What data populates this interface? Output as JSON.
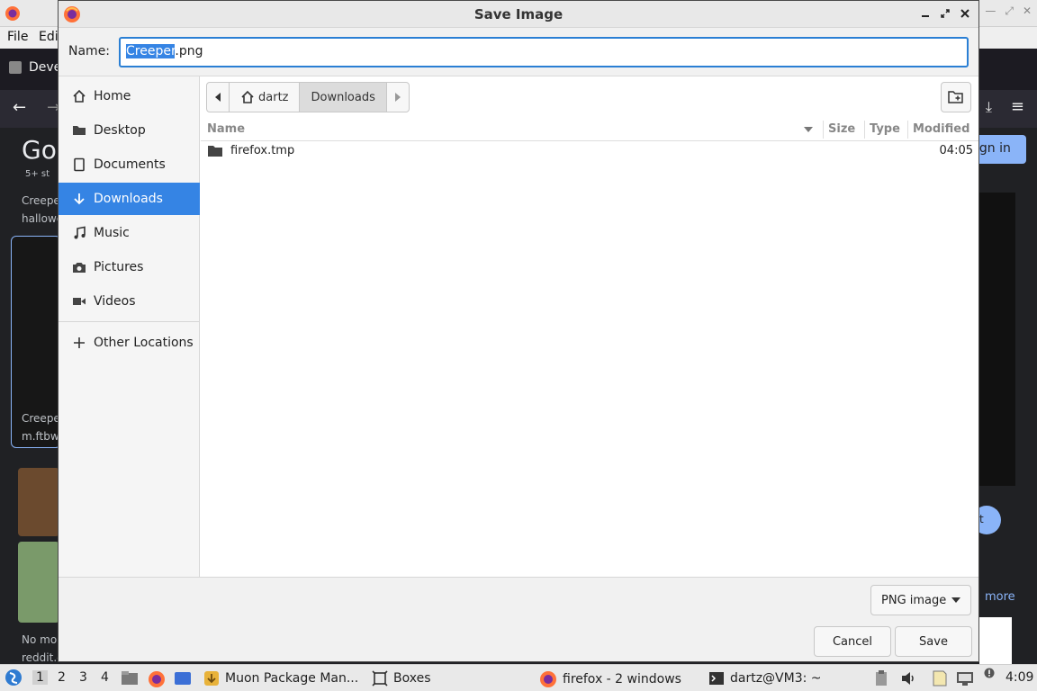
{
  "background_browser": {
    "menu": [
      "File",
      "Edi"
    ],
    "tab_label": "Deve",
    "page_logo": "Go",
    "signin_label": "ign in",
    "left_snippets": [
      "5+ st",
      "Creepe",
      "hallowe",
      "Creepe",
      "m.ftbwil",
      "No mor",
      "reddit.co"
    ],
    "right_button": "t",
    "more_label": "more"
  },
  "dialog": {
    "title": "Save Image",
    "name_label": "Name:",
    "filename_selected": "Creeper",
    "filename_rest": ".png",
    "places": [
      {
        "label": "Home",
        "icon": "home-icon"
      },
      {
        "label": "Desktop",
        "icon": "folder-icon"
      },
      {
        "label": "Documents",
        "icon": "document-icon"
      },
      {
        "label": "Downloads",
        "icon": "download-icon",
        "active": true
      },
      {
        "label": "Music",
        "icon": "music-icon"
      },
      {
        "label": "Pictures",
        "icon": "camera-icon"
      },
      {
        "label": "Videos",
        "icon": "video-icon"
      },
      {
        "label": "Other Locations",
        "icon": "plus-icon"
      }
    ],
    "path": {
      "home": "dartz",
      "current": "Downloads"
    },
    "columns": {
      "name": "Name",
      "size": "Size",
      "type": "Type",
      "modified": "Modified"
    },
    "files": [
      {
        "name": "firefox.tmp",
        "size": "",
        "type": "",
        "modified": "04:05"
      }
    ],
    "file_type": "PNG image",
    "cancel": "Cancel",
    "save": "Save"
  },
  "taskbar": {
    "workspaces": [
      "1",
      "2",
      "3",
      "4"
    ],
    "active_workspace": "1",
    "tasks": [
      {
        "label": "Muon Package Man...",
        "icon": "package-icon"
      },
      {
        "label": "Boxes",
        "icon": "boxes-icon"
      },
      {
        "label": "firefox - 2 windows",
        "icon": "firefox-icon"
      },
      {
        "label": "dartz@VM3: ~",
        "icon": "terminal-icon"
      }
    ],
    "clock": "4:09"
  },
  "colors": {
    "accent": "#3584e4",
    "focus_border": "#2a7fd4",
    "taskbar": "#e9e9e9"
  }
}
